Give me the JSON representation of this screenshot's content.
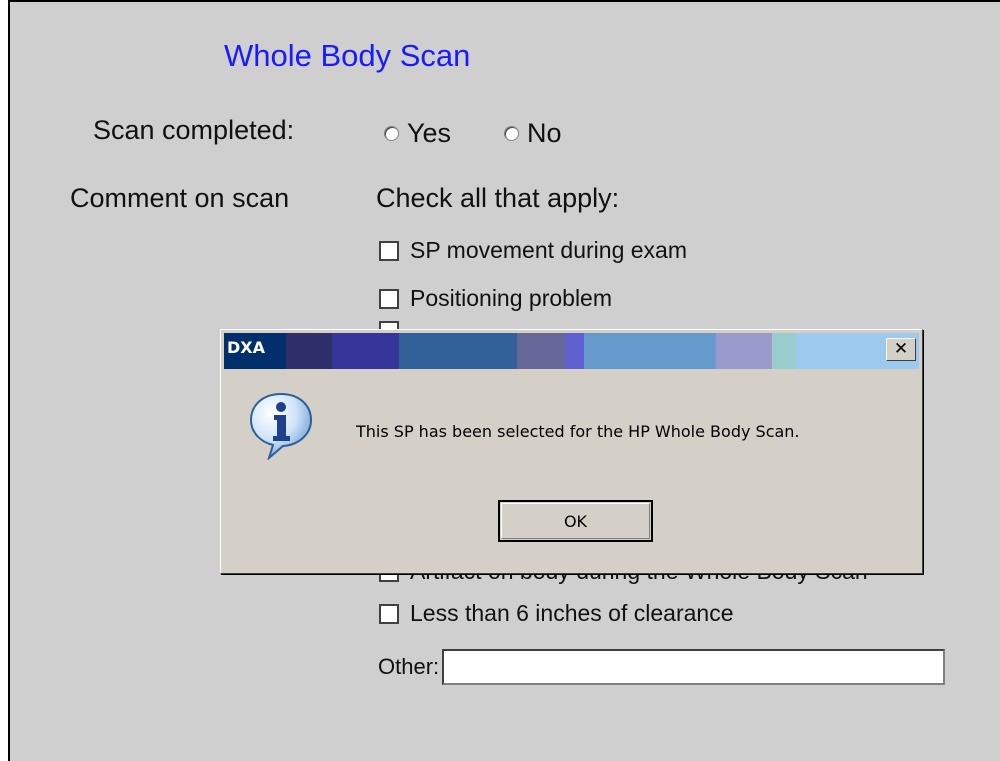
{
  "form": {
    "title": "Whole Body Scan",
    "scan_completed_label": "Scan completed:",
    "radio_yes": "Yes",
    "radio_no": "No",
    "comment_label": "Comment on scan",
    "check_all_label": "Check all that apply:",
    "checkboxes": [
      "SP movement during exam",
      "Positioning problem",
      "",
      "Less than 6 inches of clearance"
    ],
    "obscured_text": "Artifact on body during the Whole Body Scan",
    "other_label": "Other:",
    "other_value": ""
  },
  "dialog": {
    "title": "DXA",
    "close_glyph": "✕",
    "message": "This SP has been selected for the HP Whole Body Scan.",
    "ok_label": "OK",
    "titlebar_colors": [
      "#002f6c",
      "#2e2e6a",
      "#35359a",
      "#316198",
      "#666699",
      "#5f5fcf",
      "#6699cc",
      "#9999cc",
      "#99cccc",
      "#9ccaef"
    ]
  }
}
